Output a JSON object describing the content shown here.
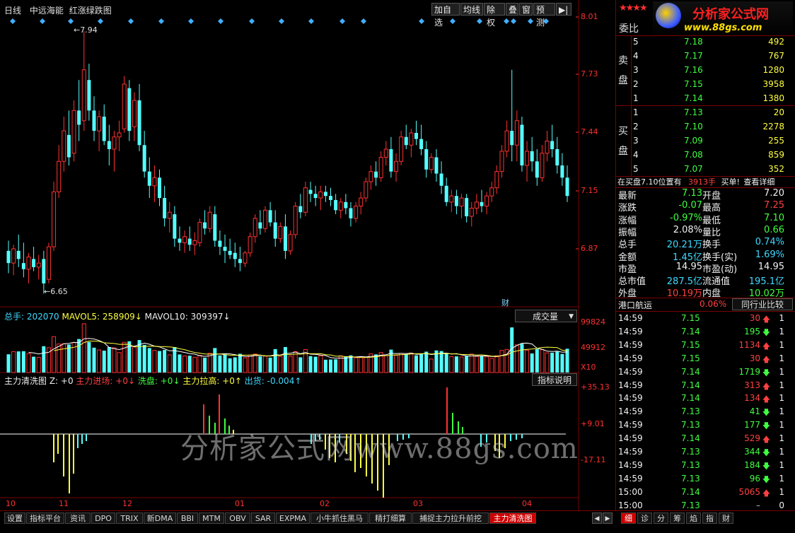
{
  "header": {
    "period": "日线",
    "stock_name": "中远海能",
    "chart_style": "红涨绿跌图",
    "toolbar": [
      "加自选",
      "均线",
      "除权",
      "叠",
      "窗",
      "预测",
      "▶|"
    ]
  },
  "colors": {
    "up": "#ff3232",
    "down": "#54ffff",
    "axis": "#7a0000",
    "ma5": "#ffffff",
    "ma10": "#ffff40"
  },
  "price_axis": {
    "labels": [
      "8.01",
      "7.73",
      "7.44",
      "7.15",
      "6.87"
    ],
    "high_mark": "7.94",
    "low_mark": "6.65"
  },
  "volume": {
    "total_label": "总手: 202070",
    "ma5_label": "MAVOL5: 258909",
    "ma10_label": "MAVOL10: 309397",
    "dropdown": "成交量",
    "axis": [
      "99824",
      "49912",
      "X10"
    ]
  },
  "indicator": {
    "name": "主力清洗图 Z: +0",
    "inflow": "主力进场: +0",
    "wash": "洗盘: +0",
    "lift": "主力拉高: +0",
    "ship": "出货: -0.004",
    "button": "指标说明",
    "axis": [
      "+35.13",
      "+9.01",
      "-17.11"
    ]
  },
  "x_axis": {
    "labels": [
      "10",
      "11",
      "12",
      "01",
      "02",
      "03",
      "04"
    ]
  },
  "fin_marker": "财",
  "watermark": "分析家公式网www.88gs.com",
  "logo": {
    "title": "分析家公式网",
    "url": "www.88gs.com"
  },
  "right_panel": {
    "weibi": "委比",
    "sell_label": "卖盘",
    "buy_label": "买盘",
    "sell_orders": [
      {
        "level": "5",
        "price": "7.18",
        "volume": "492"
      },
      {
        "level": "4",
        "price": "7.17",
        "volume": "767"
      },
      {
        "level": "3",
        "price": "7.16",
        "volume": "1280"
      },
      {
        "level": "2",
        "price": "7.15",
        "volume": "3958"
      },
      {
        "level": "1",
        "price": "7.14",
        "volume": "1380"
      }
    ],
    "buy_orders": [
      {
        "level": "1",
        "price": "7.13",
        "volume": "20"
      },
      {
        "level": "2",
        "price": "7.10",
        "volume": "2278"
      },
      {
        "level": "3",
        "price": "7.09",
        "volume": "255"
      },
      {
        "level": "4",
        "price": "7.08",
        "volume": "859"
      },
      {
        "level": "5",
        "price": "7.07",
        "volume": "352"
      }
    ],
    "notice": {
      "text": "在买盘7.10位置有",
      "volume": "3913手",
      "action": "买单!",
      "link": "查看详细"
    },
    "quotes": [
      {
        "l1": "最新",
        "v1": "7.13",
        "c1": "green",
        "l2": "开盘",
        "v2": "7.20",
        "c2": "white"
      },
      {
        "l1": "涨跌",
        "v1": "-0.07",
        "c1": "green",
        "l2": "最高",
        "v2": "7.25",
        "c2": "red"
      },
      {
        "l1": "涨幅",
        "v1": "-0.97%",
        "c1": "green",
        "l2": "最低",
        "v2": "7.10",
        "c2": "green"
      },
      {
        "l1": "振幅",
        "v1": "2.08%",
        "c1": "white",
        "l2": "量比",
        "v2": "0.66",
        "c2": "green"
      },
      {
        "l1": "总手",
        "v1": "20.21万",
        "c1": "cyan",
        "l2": "换手",
        "v2": "0.74%",
        "c2": "cyan"
      },
      {
        "l1": "金额",
        "v1": "1.45亿",
        "c1": "cyan",
        "l2": "换手(实)",
        "v2": "1.69%",
        "c2": "cyan"
      },
      {
        "l1": "市盈",
        "v1": "14.95",
        "c1": "white",
        "l2": "市盈(动)",
        "v2": "14.95",
        "c2": "white"
      },
      {
        "l1": "总市值",
        "v1": "287.5亿",
        "c1": "cyan",
        "l2": "流通值",
        "v2": "195.1亿",
        "c2": "cyan"
      },
      {
        "l1": "外盘",
        "v1": "10.19万",
        "c1": "red",
        "l2": "内盘",
        "v2": "10.02万",
        "c2": "green"
      }
    ],
    "sector": {
      "name": "港口航运",
      "change": "0.06%",
      "button": "同行业比较"
    },
    "ticks": [
      {
        "time": "14:59",
        "price": "7.15",
        "vol": "30",
        "dir": "up",
        "n": "1"
      },
      {
        "time": "14:59",
        "price": "7.14",
        "vol": "195",
        "dir": "down",
        "n": "1"
      },
      {
        "time": "14:59",
        "price": "7.15",
        "vol": "1134",
        "dir": "up",
        "n": "1"
      },
      {
        "time": "14:59",
        "price": "7.15",
        "vol": "30",
        "dir": "up",
        "n": "1"
      },
      {
        "time": "14:59",
        "price": "7.14",
        "vol": "1719",
        "dir": "down",
        "n": "1"
      },
      {
        "time": "14:59",
        "price": "7.14",
        "vol": "313",
        "dir": "up",
        "n": "1"
      },
      {
        "time": "14:59",
        "price": "7.14",
        "vol": "134",
        "dir": "up",
        "n": "1"
      },
      {
        "time": "14:59",
        "price": "7.13",
        "vol": "41",
        "dir": "down",
        "n": "1"
      },
      {
        "time": "14:59",
        "price": "7.13",
        "vol": "177",
        "dir": "down",
        "n": "1"
      },
      {
        "time": "14:59",
        "price": "7.14",
        "vol": "529",
        "dir": "up",
        "n": "1"
      },
      {
        "time": "14:59",
        "price": "7.13",
        "vol": "344",
        "dir": "down",
        "n": "1"
      },
      {
        "time": "14:59",
        "price": "7.13",
        "vol": "184",
        "dir": "down",
        "n": "1"
      },
      {
        "time": "14:59",
        "price": "7.13",
        "vol": "96",
        "dir": "down",
        "n": "1"
      },
      {
        "time": "15:00",
        "price": "7.14",
        "vol": "5065",
        "dir": "up",
        "n": "1"
      },
      {
        "time": "15:00",
        "price": "7.13",
        "vol": "–",
        "dir": "none",
        "n": "0"
      }
    ],
    "tabs": [
      "细",
      "诊",
      "分",
      "筹",
      "焰",
      "指",
      "财"
    ]
  },
  "bottom_tabs": [
    "设置",
    "指标平台",
    "资讯",
    "DPO",
    "TRIX",
    "新DMA",
    "BBI",
    "MTM",
    "OBV",
    "SAR",
    "EXPMA",
    "小牛抓住黑马",
    "精打细算",
    "捕捉主力拉升前挖",
    "主力清洗图"
  ],
  "chart_data": {
    "type": "candlestick",
    "series": [
      {
        "o": 6.86,
        "h": 6.91,
        "l": 6.75,
        "c": 6.8
      },
      {
        "o": 6.8,
        "h": 6.89,
        "l": 6.74,
        "c": 6.87
      },
      {
        "o": 6.86,
        "h": 6.94,
        "l": 6.78,
        "c": 6.82
      },
      {
        "o": 6.8,
        "h": 6.9,
        "l": 6.73,
        "c": 6.77
      },
      {
        "o": 6.77,
        "h": 6.85,
        "l": 6.7,
        "c": 6.83
      },
      {
        "o": 6.82,
        "h": 6.88,
        "l": 6.76,
        "c": 6.78
      },
      {
        "o": 6.78,
        "h": 6.84,
        "l": 6.72,
        "c": 6.8
      },
      {
        "o": 6.82,
        "h": 6.86,
        "l": 6.65,
        "c": 6.7
      },
      {
        "o": 6.72,
        "h": 6.9,
        "l": 6.7,
        "c": 6.88
      },
      {
        "o": 6.88,
        "h": 7.2,
        "l": 6.86,
        "c": 7.15
      },
      {
        "o": 7.15,
        "h": 7.38,
        "l": 7.12,
        "c": 7.3
      },
      {
        "o": 7.3,
        "h": 7.52,
        "l": 7.25,
        "c": 7.45
      },
      {
        "o": 7.43,
        "h": 7.55,
        "l": 7.28,
        "c": 7.32
      },
      {
        "o": 7.34,
        "h": 7.6,
        "l": 7.3,
        "c": 7.55
      },
      {
        "o": 7.55,
        "h": 7.7,
        "l": 7.4,
        "c": 7.48
      },
      {
        "o": 7.5,
        "h": 7.94,
        "l": 7.45,
        "c": 7.75
      },
      {
        "o": 7.7,
        "h": 7.78,
        "l": 7.5,
        "c": 7.55
      },
      {
        "o": 7.55,
        "h": 7.62,
        "l": 7.4,
        "c": 7.45
      },
      {
        "o": 7.45,
        "h": 7.55,
        "l": 7.35,
        "c": 7.52
      },
      {
        "o": 7.52,
        "h": 7.58,
        "l": 7.38,
        "c": 7.4
      },
      {
        "o": 7.4,
        "h": 7.48,
        "l": 7.28,
        "c": 7.36
      },
      {
        "o": 7.36,
        "h": 7.45,
        "l": 7.25,
        "c": 7.42
      },
      {
        "o": 7.42,
        "h": 7.5,
        "l": 7.35,
        "c": 7.44
      },
      {
        "o": 7.46,
        "h": 7.72,
        "l": 7.44,
        "c": 7.68
      },
      {
        "o": 7.66,
        "h": 7.7,
        "l": 7.4,
        "c": 7.45
      },
      {
        "o": 7.47,
        "h": 7.64,
        "l": 7.4,
        "c": 7.6
      },
      {
        "o": 7.6,
        "h": 7.68,
        "l": 7.35,
        "c": 7.38
      },
      {
        "o": 7.38,
        "h": 7.45,
        "l": 7.22,
        "c": 7.25
      },
      {
        "o": 7.25,
        "h": 7.32,
        "l": 7.12,
        "c": 7.18
      },
      {
        "o": 7.18,
        "h": 7.28,
        "l": 7.1,
        "c": 7.22
      },
      {
        "o": 7.22,
        "h": 7.26,
        "l": 7.08,
        "c": 7.12
      },
      {
        "o": 7.12,
        "h": 7.18,
        "l": 6.98,
        "c": 7.02
      },
      {
        "o": 7.02,
        "h": 7.1,
        "l": 6.95,
        "c": 7.05
      },
      {
        "o": 7.04,
        "h": 7.08,
        "l": 6.88,
        "c": 6.92
      },
      {
        "o": 6.92,
        "h": 6.98,
        "l": 6.86,
        "c": 6.9
      },
      {
        "o": 6.9,
        "h": 6.96,
        "l": 6.85,
        "c": 6.93
      },
      {
        "o": 6.92,
        "h": 6.98,
        "l": 6.86,
        "c": 6.89
      },
      {
        "o": 6.89,
        "h": 6.95,
        "l": 6.84,
        "c": 6.91
      },
      {
        "o": 6.9,
        "h": 7.02,
        "l": 6.88,
        "c": 7.0
      },
      {
        "o": 7.0,
        "h": 7.06,
        "l": 6.94,
        "c": 6.97
      },
      {
        "o": 6.97,
        "h": 7.08,
        "l": 6.95,
        "c": 7.05
      },
      {
        "o": 7.04,
        "h": 7.08,
        "l": 6.88,
        "c": 6.91
      },
      {
        "o": 6.91,
        "h": 6.96,
        "l": 6.84,
        "c": 6.88
      },
      {
        "o": 6.88,
        "h": 6.94,
        "l": 6.8,
        "c": 6.86
      },
      {
        "o": 6.86,
        "h": 6.92,
        "l": 6.82,
        "c": 6.84
      },
      {
        "o": 6.85,
        "h": 6.9,
        "l": 6.78,
        "c": 6.82
      },
      {
        "o": 6.82,
        "h": 6.88,
        "l": 6.76,
        "c": 6.8
      },
      {
        "o": 6.8,
        "h": 6.86,
        "l": 6.78,
        "c": 6.85
      },
      {
        "o": 6.85,
        "h": 6.95,
        "l": 6.83,
        "c": 6.93
      },
      {
        "o": 6.93,
        "h": 7.04,
        "l": 6.9,
        "c": 7.02
      },
      {
        "o": 7.0,
        "h": 7.06,
        "l": 6.94,
        "c": 6.97
      },
      {
        "o": 6.97,
        "h": 7.08,
        "l": 6.95,
        "c": 7.06
      },
      {
        "o": 7.06,
        "h": 7.1,
        "l": 6.98,
        "c": 7.0
      },
      {
        "o": 7.0,
        "h": 7.06,
        "l": 6.88,
        "c": 6.92
      },
      {
        "o": 6.92,
        "h": 7.0,
        "l": 6.9,
        "c": 6.98
      },
      {
        "o": 6.98,
        "h": 7.04,
        "l": 6.82,
        "c": 6.86
      },
      {
        "o": 6.86,
        "h": 6.96,
        "l": 6.84,
        "c": 6.94
      },
      {
        "o": 6.94,
        "h": 7.1,
        "l": 6.92,
        "c": 7.08
      },
      {
        "o": 7.08,
        "h": 7.14,
        "l": 7.02,
        "c": 7.05
      },
      {
        "o": 7.05,
        "h": 7.2,
        "l": 7.03,
        "c": 7.17
      },
      {
        "o": 7.16,
        "h": 7.2,
        "l": 7.1,
        "c": 7.14
      },
      {
        "o": 7.14,
        "h": 7.18,
        "l": 7.08,
        "c": 7.12
      },
      {
        "o": 7.12,
        "h": 7.18,
        "l": 7.06,
        "c": 7.15
      },
      {
        "o": 7.15,
        "h": 7.18,
        "l": 7.1,
        "c": 7.13
      },
      {
        "o": 7.13,
        "h": 7.17,
        "l": 7.08,
        "c": 7.11
      },
      {
        "o": 7.11,
        "h": 7.14,
        "l": 7.04,
        "c": 7.06
      },
      {
        "o": 7.06,
        "h": 7.12,
        "l": 7.02,
        "c": 7.1
      },
      {
        "o": 7.1,
        "h": 7.14,
        "l": 7.04,
        "c": 7.07
      },
      {
        "o": 7.07,
        "h": 7.1,
        "l": 6.98,
        "c": 7.02
      },
      {
        "o": 7.02,
        "h": 7.1,
        "l": 7.0,
        "c": 7.08
      },
      {
        "o": 7.08,
        "h": 7.15,
        "l": 7.04,
        "c": 7.12
      },
      {
        "o": 7.12,
        "h": 7.22,
        "l": 7.1,
        "c": 7.2
      },
      {
        "o": 7.2,
        "h": 7.28,
        "l": 7.16,
        "c": 7.25
      },
      {
        "o": 7.25,
        "h": 7.3,
        "l": 7.18,
        "c": 7.22
      },
      {
        "o": 7.22,
        "h": 7.35,
        "l": 7.2,
        "c": 7.32
      },
      {
        "o": 7.32,
        "h": 7.4,
        "l": 7.28,
        "c": 7.36
      },
      {
        "o": 7.36,
        "h": 7.42,
        "l": 7.22,
        "c": 7.25
      },
      {
        "o": 7.25,
        "h": 7.34,
        "l": 7.2,
        "c": 7.3
      },
      {
        "o": 7.3,
        "h": 7.45,
        "l": 7.28,
        "c": 7.42
      },
      {
        "o": 7.42,
        "h": 7.48,
        "l": 7.36,
        "c": 7.38
      },
      {
        "o": 7.38,
        "h": 7.46,
        "l": 7.32,
        "c": 7.44
      },
      {
        "o": 7.44,
        "h": 7.5,
        "l": 7.38,
        "c": 7.41
      },
      {
        "o": 7.41,
        "h": 7.48,
        "l": 7.33,
        "c": 7.36
      },
      {
        "o": 7.36,
        "h": 7.4,
        "l": 7.22,
        "c": 7.26
      },
      {
        "o": 7.26,
        "h": 7.34,
        "l": 7.24,
        "c": 7.32
      },
      {
        "o": 7.32,
        "h": 7.36,
        "l": 7.2,
        "c": 7.24
      },
      {
        "o": 7.24,
        "h": 7.3,
        "l": 7.14,
        "c": 7.18
      },
      {
        "o": 7.18,
        "h": 7.22,
        "l": 7.08,
        "c": 7.1
      },
      {
        "o": 7.1,
        "h": 7.16,
        "l": 7.05,
        "c": 7.13
      },
      {
        "o": 7.13,
        "h": 7.16,
        "l": 7.04,
        "c": 7.08
      },
      {
        "o": 7.08,
        "h": 7.14,
        "l": 7.02,
        "c": 7.12
      },
      {
        "o": 7.12,
        "h": 7.14,
        "l": 7.0,
        "c": 7.03
      },
      {
        "o": 7.03,
        "h": 7.1,
        "l": 6.98,
        "c": 7.07
      },
      {
        "o": 7.07,
        "h": 7.14,
        "l": 7.04,
        "c": 7.1
      },
      {
        "o": 7.1,
        "h": 7.16,
        "l": 7.05,
        "c": 7.08
      },
      {
        "o": 7.08,
        "h": 7.15,
        "l": 7.04,
        "c": 7.13
      },
      {
        "o": 7.13,
        "h": 7.2,
        "l": 7.1,
        "c": 7.17
      },
      {
        "o": 7.17,
        "h": 7.28,
        "l": 7.14,
        "c": 7.25
      },
      {
        "o": 7.25,
        "h": 7.38,
        "l": 7.22,
        "c": 7.35
      },
      {
        "o": 7.35,
        "h": 7.5,
        "l": 7.32,
        "c": 7.45
      },
      {
        "o": 7.45,
        "h": 7.75,
        "l": 7.3,
        "c": 7.38
      },
      {
        "o": 7.38,
        "h": 7.55,
        "l": 7.3,
        "c": 7.5
      },
      {
        "o": 7.48,
        "h": 7.52,
        "l": 7.25,
        "c": 7.28
      },
      {
        "o": 7.28,
        "h": 7.4,
        "l": 7.2,
        "c": 7.35
      },
      {
        "o": 7.35,
        "h": 7.42,
        "l": 7.25,
        "c": 7.3
      },
      {
        "o": 7.3,
        "h": 7.36,
        "l": 7.18,
        "c": 7.22
      },
      {
        "o": 7.22,
        "h": 7.38,
        "l": 7.2,
        "c": 7.34
      },
      {
        "o": 7.34,
        "h": 7.45,
        "l": 7.3,
        "c": 7.4
      },
      {
        "o": 7.4,
        "h": 7.48,
        "l": 7.32,
        "c": 7.36
      },
      {
        "o": 7.36,
        "h": 7.42,
        "l": 7.24,
        "c": 7.28
      },
      {
        "o": 7.28,
        "h": 7.34,
        "l": 7.18,
        "c": 7.22
      },
      {
        "o": 7.22,
        "h": 7.28,
        "l": 7.1,
        "c": 7.13
      }
    ]
  }
}
